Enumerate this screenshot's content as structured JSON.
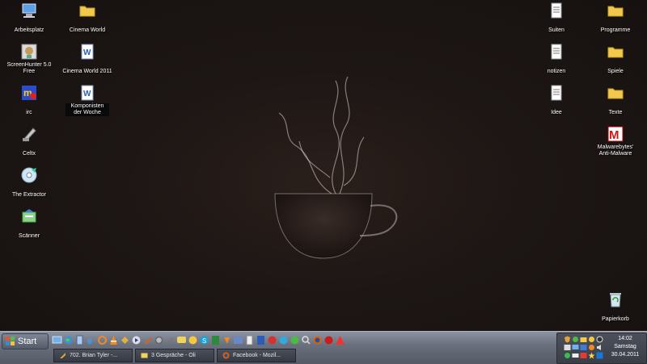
{
  "desktop": {
    "icons_left_col1": [
      {
        "name": "Arbeitsplatz",
        "icon": "computer-icon"
      },
      {
        "name": "ScreenHunter 5.0 Free",
        "icon": "screenhunter-icon"
      },
      {
        "name": "irc",
        "icon": "irc-icon"
      },
      {
        "name": "Celtx",
        "icon": "celtx-icon"
      },
      {
        "name": "The Extractor",
        "icon": "cd-icon"
      },
      {
        "name": "Scänner",
        "icon": "scanner-icon"
      }
    ],
    "icons_left_col2": [
      {
        "name": "Cinema World",
        "icon": "folder-icon"
      },
      {
        "name": "Cinema World 2011",
        "icon": "word-doc-icon"
      },
      {
        "name": "Komponisten der Woche",
        "icon": "word-doc-icon"
      }
    ],
    "icons_right_col1": [
      {
        "name": "Suiten",
        "icon": "text-doc-icon"
      },
      {
        "name": "notizen",
        "icon": "text-doc-icon"
      },
      {
        "name": "Idee",
        "icon": "text-doc-icon"
      }
    ],
    "icons_right_col2": [
      {
        "name": "Programme",
        "icon": "folder-icon"
      },
      {
        "name": "Spiele",
        "icon": "folder-icon"
      },
      {
        "name": "Texte",
        "icon": "folder-icon"
      },
      {
        "name": "Malwarebytes' Anti-Malware",
        "icon": "malwarebytes-icon"
      },
      {
        "name": "Papierkorb",
        "icon": "recycle-bin-icon"
      }
    ]
  },
  "taskbar": {
    "start_label": "Start",
    "tasks": [
      {
        "label": "702. Brian Tyler -...",
        "icon": "app-icon"
      },
      {
        "label": "3 Gespräche - Oli",
        "icon": "chat-icon"
      },
      {
        "label": "Facebook - Mozil...",
        "icon": "firefox-icon"
      }
    ],
    "clock": {
      "time": "14:02",
      "day": "Samstag",
      "date": "30.04.2011"
    }
  },
  "colors": {
    "folder": "#f2c94c",
    "taskbar": "#6a707d",
    "background": "#1c1513"
  }
}
